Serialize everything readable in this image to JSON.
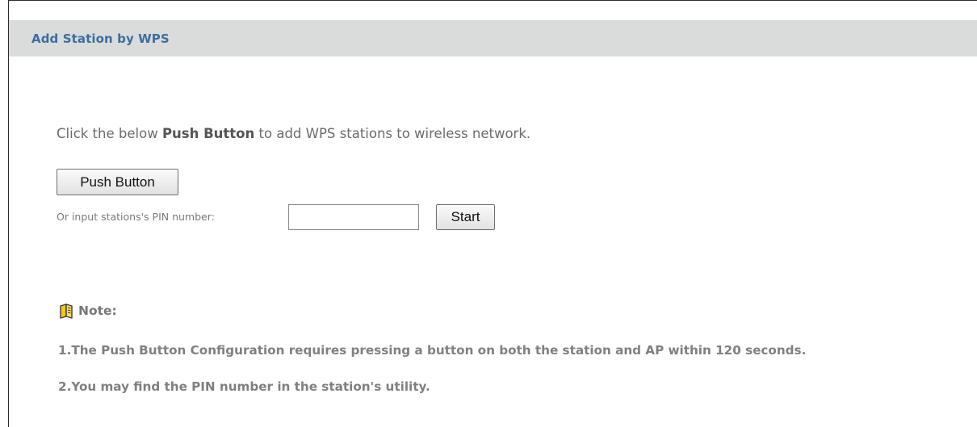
{
  "panel": {
    "title": "Add Station by WPS"
  },
  "intro": {
    "before": "Click the below ",
    "bold": "Push Button",
    "after": " to add WPS stations to wireless network."
  },
  "push_button_label": "Push Button",
  "pin": {
    "label": "Or input stations's PIN number:",
    "value": "",
    "start_label": "Start"
  },
  "note": {
    "title": "Note:",
    "icon": "note-book-icon",
    "lines": [
      "1.The Push Button Configuration requires pressing a button on both the station and AP within 120 seconds.",
      "2.You may find the PIN number in the station's utility."
    ]
  },
  "colors": {
    "title_text": "#3e6d9e",
    "title_bar_bg": "#d9dcdb",
    "icon_yellow": "#f4c820"
  }
}
